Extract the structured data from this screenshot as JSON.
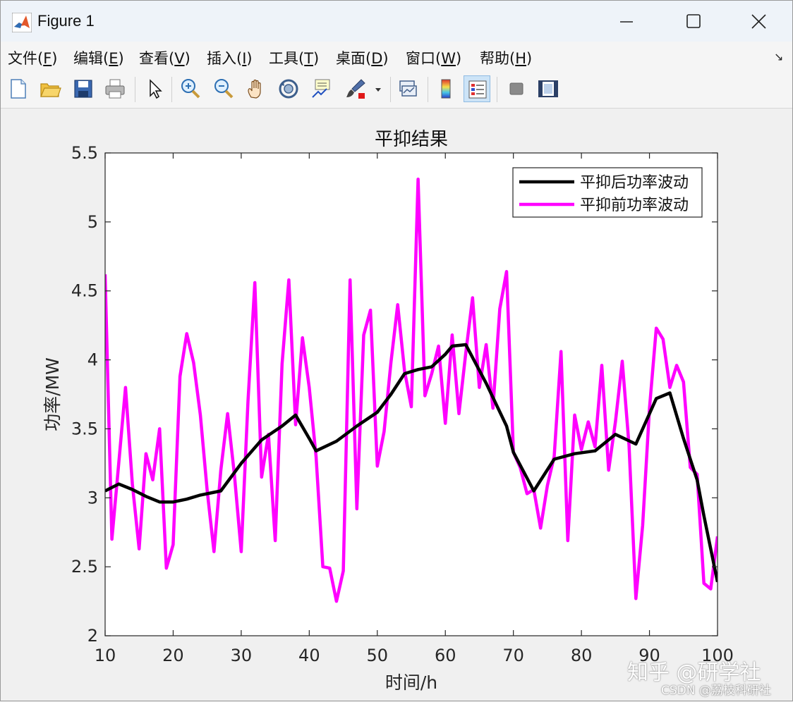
{
  "window": {
    "title": "Figure 1"
  },
  "menu": {
    "items": [
      {
        "label": "文件",
        "key": "F"
      },
      {
        "label": "编辑",
        "key": "E"
      },
      {
        "label": "查看",
        "key": "V"
      },
      {
        "label": "插入",
        "key": "I"
      },
      {
        "label": "工具",
        "key": "T"
      },
      {
        "label": "桌面",
        "key": "D"
      },
      {
        "label": "窗口",
        "key": "W"
      },
      {
        "label": "帮助",
        "key": "H"
      }
    ]
  },
  "toolbar": {
    "icons": [
      "new-figure-icon",
      "open-file-icon",
      "save-icon",
      "print-icon",
      "select-arrow-icon",
      "zoom-in-icon",
      "zoom-out-icon",
      "pan-hand-icon",
      "rotate-3d-icon",
      "data-cursor-icon",
      "brush-icon",
      "brush-dropdown-icon",
      "link-plot-icon",
      "colorbar-icon",
      "legend-icon",
      "hide-plot-tools-icon",
      "show-plot-tools-icon"
    ]
  },
  "watermark": {
    "line1": "知乎 @研学社",
    "line2": "CSDN @荔枝科研社"
  },
  "colors": {
    "after": "#000000",
    "before": "#ff00ff"
  },
  "chart_data": {
    "type": "line",
    "title": "平抑结果",
    "xlabel": "时间/h",
    "ylabel": "功率/MW",
    "xlim": [
      10,
      100
    ],
    "ylim": [
      2,
      5.5
    ],
    "xticks": [
      10,
      20,
      30,
      40,
      50,
      60,
      70,
      80,
      90,
      100
    ],
    "yticks": [
      2,
      2.5,
      3,
      3.5,
      4,
      4.5,
      5,
      5.5
    ],
    "grid": false,
    "legend_position": "top-right",
    "series": [
      {
        "name": "平抑后功率波动",
        "color": "#000000",
        "x": [
          10,
          12,
          14,
          16,
          18,
          20,
          22,
          24,
          26,
          27,
          30,
          33,
          36,
          38,
          40,
          41,
          44,
          47,
          50,
          52,
          54,
          56,
          58,
          60,
          61,
          63,
          66,
          69,
          70,
          73,
          76,
          79,
          82,
          85,
          88,
          91,
          93,
          95,
          97,
          98,
          100
        ],
        "y": [
          3.05,
          3.1,
          3.06,
          3.01,
          2.97,
          2.97,
          2.99,
          3.02,
          3.04,
          3.05,
          3.25,
          3.42,
          3.52,
          3.6,
          3.43,
          3.34,
          3.41,
          3.52,
          3.62,
          3.75,
          3.9,
          3.93,
          3.95,
          4.04,
          4.1,
          4.11,
          3.83,
          3.52,
          3.33,
          3.05,
          3.28,
          3.32,
          3.34,
          3.46,
          3.39,
          3.72,
          3.76,
          3.43,
          3.13,
          2.87,
          2.39
        ]
      },
      {
        "name": "平抑前功率波动",
        "color": "#ff00ff",
        "x": [
          10,
          11,
          12,
          13,
          14,
          15,
          16,
          17,
          18,
          19,
          20,
          21,
          22,
          23,
          24,
          25,
          26,
          27,
          28,
          29,
          30,
          31,
          32,
          33,
          34,
          35,
          36,
          37,
          38,
          39,
          40,
          41,
          42,
          43,
          44,
          45,
          46,
          47,
          48,
          49,
          50,
          51,
          52,
          53,
          54,
          55,
          56,
          57,
          58,
          59,
          60,
          61,
          62,
          63,
          64,
          65,
          66,
          67,
          68,
          69,
          70,
          71,
          72,
          73,
          74,
          75,
          76,
          77,
          78,
          79,
          80,
          81,
          82,
          83,
          84,
          85,
          86,
          87,
          88,
          89,
          90,
          91,
          92,
          93,
          94,
          95,
          96,
          97,
          98,
          99,
          100
        ],
        "y": [
          4.62,
          2.7,
          3.25,
          3.8,
          3.1,
          2.63,
          3.32,
          3.13,
          3.5,
          2.49,
          2.66,
          3.88,
          4.19,
          3.98,
          3.6,
          3.05,
          2.61,
          3.2,
          3.61,
          3.17,
          2.61,
          3.7,
          4.56,
          3.15,
          3.46,
          2.69,
          3.97,
          4.58,
          3.53,
          4.16,
          3.8,
          3.3,
          2.5,
          2.49,
          2.25,
          2.47,
          4.58,
          2.92,
          4.18,
          4.36,
          3.23,
          3.48,
          3.98,
          4.4,
          3.92,
          3.66,
          5.31,
          3.74,
          3.9,
          4.1,
          3.54,
          4.18,
          3.61,
          4.05,
          4.45,
          3.8,
          4.11,
          3.65,
          4.37,
          4.64,
          3.33,
          3.22,
          3.03,
          3.06,
          2.78,
          3.09,
          3.3,
          4.06,
          2.69,
          3.6,
          3.35,
          3.55,
          3.37,
          3.96,
          3.2,
          3.55,
          3.99,
          3.38,
          2.27,
          2.8,
          3.65,
          4.23,
          4.15,
          3.8,
          3.96,
          3.84,
          3.22,
          3.17,
          2.38,
          2.34,
          2.72
        ]
      }
    ]
  }
}
